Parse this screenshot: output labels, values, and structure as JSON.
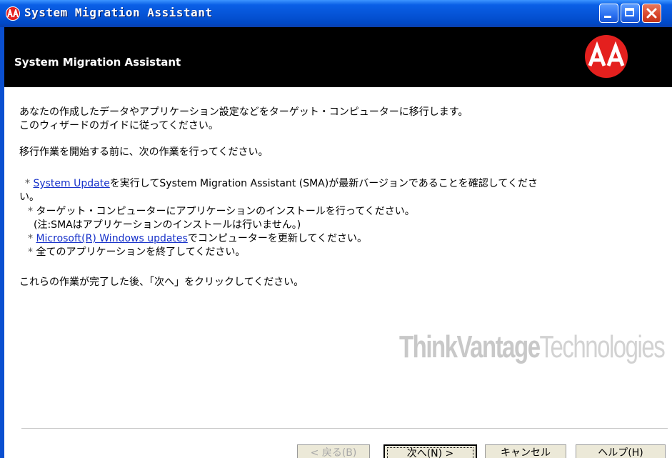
{
  "window": {
    "title": "System Migration Assistant"
  },
  "header": {
    "title": "System Migration Assistant",
    "logo_color": "#e4201e"
  },
  "content": {
    "intro_line1": "あなたの作成したデータやアプリケーション設定などをターゲット・コンピューターに移行します。",
    "intro_line2": "このウィザードのガイドに従ってください。",
    "before_line": "移行作業を開始する前に、次の作業を行ってください。",
    "bullet_marker": "*",
    "item1_link": "System Update",
    "item1_text": "を実行してSystem Migration Assistant (SMA)が最新バージョンであることを確認してくださ",
    "item1_wrap": "い。",
    "item2_text": "ターゲット・コンピューターにアプリケーションのインストールを行ってください。",
    "item2_note": "(注:SMAはアプリケーションのインストールは行いません。)",
    "item3_link": "Microsoft(R) Windows updates",
    "item3_text": "でコンピューターを更新してください。",
    "item4_text": "全てのアプリケーションを終了してください。",
    "closing_line": "これらの作業が完了した後、「次へ」をクリックしてください。"
  },
  "watermark": {
    "bold_part": "ThinkVantage",
    "light_part": "Technologies"
  },
  "buttons": {
    "back_label": "< 戻る(B)",
    "next_label": "次へ(N) >",
    "cancel_label": "キャンセル",
    "help_label": "ヘルプ(H)"
  },
  "colors": {
    "link": "#1530c9",
    "titlebar": "#0553d6",
    "header_band": "#000000"
  }
}
